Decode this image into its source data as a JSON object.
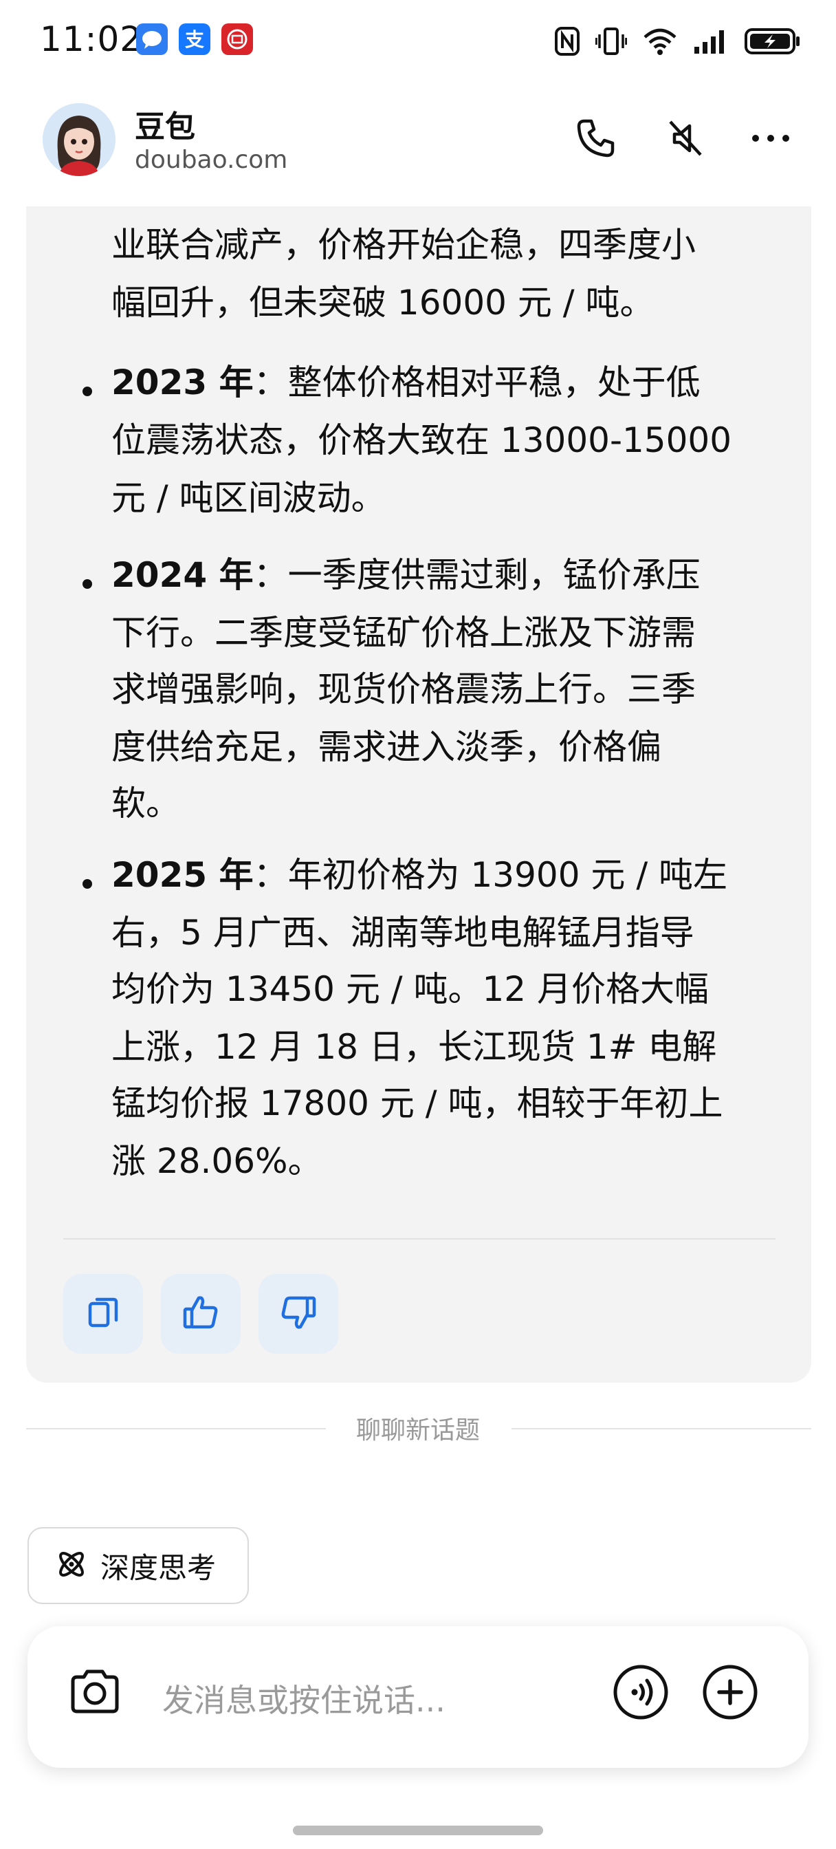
{
  "status_bar": {
    "time": "11:02",
    "notification_icons": [
      "message-app-icon",
      "alipay-icon",
      "bank-app-icon"
    ],
    "right_icons": [
      "nfc-icon",
      "vibrate-icon",
      "wifi-icon",
      "signal-icon",
      "battery-charging-icon"
    ]
  },
  "header": {
    "title": "豆包",
    "subtitle": "doubao.com",
    "actions": [
      "phone-icon",
      "speaker-muted-icon",
      "more-icon"
    ]
  },
  "message": {
    "lines": [
      {
        "bold": "",
        "text": "业联合减产，价格开始企稳，四季度小"
      },
      {
        "bold": "",
        "text": "幅回升，但未突破 16000 元 / 吨。"
      },
      {
        "bold": "2023 年",
        "text": "：整体价格相对平稳，处于低"
      },
      {
        "bold": "",
        "text": "位震荡状态，价格大致在 13000-15000"
      },
      {
        "bold": "",
        "text": "元 / 吨区间波动。"
      },
      {
        "bold": "2024 年",
        "text": "：一季度供需过剩，锰价承压"
      },
      {
        "bold": "",
        "text": "下行。二季度受锰矿价格上涨及下游需"
      },
      {
        "bold": "",
        "text": "求增强影响，现货价格震荡上行。三季"
      },
      {
        "bold": "",
        "text": "度供给充足，需求进入淡季，价格偏"
      },
      {
        "bold": "",
        "text": "软。"
      },
      {
        "bold": "2025 年",
        "text": "：年初价格为 13900 元 / 吨左"
      },
      {
        "bold": "",
        "text": "右，5 月广西、湖南等地电解锰月指导"
      },
      {
        "bold": "",
        "text": "均价为 13450 元 / 吨。12 月价格大幅"
      },
      {
        "bold": "",
        "text": "上涨，12 月 18 日，长江现货 1# 电解"
      },
      {
        "bold": "",
        "text": "锰均价报 17800 元 / 吨，相较于年初上"
      },
      {
        "bold": "",
        "text": "涨 28.06%。"
      }
    ],
    "actions": [
      "copy-icon",
      "thumbs-up-icon",
      "thumbs-down-icon"
    ]
  },
  "new_topic_label": "聊聊新话题",
  "deep_think_label": "深度思考",
  "input": {
    "placeholder": "发消息或按住说话..."
  },
  "colors": {
    "accent": "#1f6fe0",
    "card_bg": "#f3f3f3",
    "action_bg": "#e6eef8"
  }
}
